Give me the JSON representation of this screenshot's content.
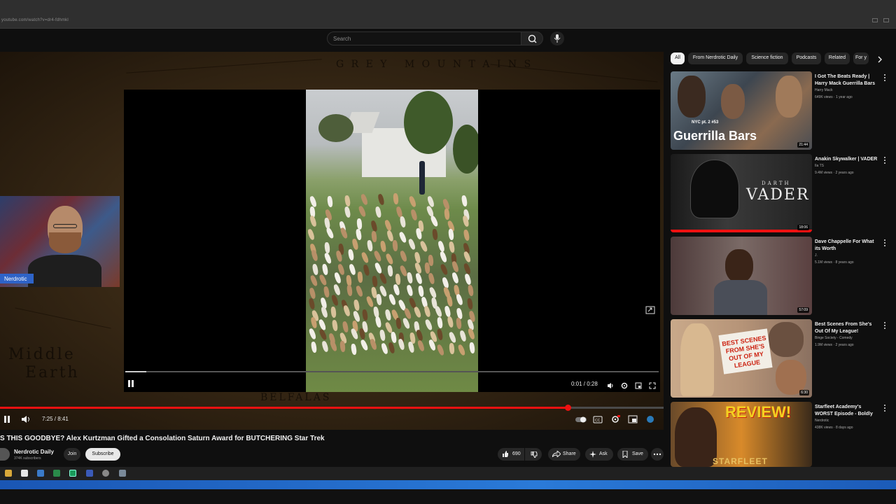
{
  "browser": {
    "url": "youtube.com/watch?v=dr4-fdhmkl"
  },
  "header": {
    "search_placeholder": "Search",
    "icons": [
      "search-icon",
      "microphone-icon"
    ]
  },
  "player": {
    "embedded_video": {
      "current_time": "0:01 / 0:28",
      "progress": 0.04
    },
    "webcam_label": "Nerdrotic",
    "current_time": "7:25 / 8:41",
    "progress": 0.855,
    "colors": {
      "progress": "#ee1111",
      "webcam_label_bg": "#2e63c8"
    }
  },
  "video": {
    "title": "S THIS GOODBYE? Alex Kurtzman Gifted a Consolation Saturn Award for BUTCHERING Star Trek",
    "channel": "Nerdrotic Daily",
    "subscribers": "374K subscribers",
    "join_label": "Join",
    "subscribe_label": "Subscribe",
    "likes": "690",
    "share_label": "Share",
    "ask_label": "Ask",
    "save_label": "Save"
  },
  "chips": [
    "All",
    "From Nerdrotic Daily",
    "Science fiction",
    "Podcasts",
    "Related",
    "For y"
  ],
  "recommendations": [
    {
      "title": "I Got The Beats Ready | Harry Mack Guerrilla Bars ...",
      "channel": "Harry Mack",
      "meta": "649K views · 1 year ago",
      "duration": "21:44",
      "thumb_text": "Guerrilla Bars",
      "thumb_subtext": "NYC pt. 2 #53"
    },
    {
      "title": "Anakin Skywalker | VADER",
      "channel": "Ila TS",
      "meta": "9.4M views · 2 years ago",
      "duration": "18:06",
      "thumb_text": "VADER",
      "thumb_subtext": "DARTH"
    },
    {
      "title": "Dave Chappelle For What its Worth",
      "channel": "J.",
      "meta": "5.1M views · 8 years ago",
      "duration": "57:09"
    },
    {
      "title": "Best Scenes From She's Out Of My League!",
      "channel": "Binge Society - Comedy",
      "meta": "1.9M views · 2 years ago",
      "duration": "6:30",
      "thumb_text": "BEST SCENES FROM SHE'S OUT OF MY LEAGUE"
    },
    {
      "title": "Starfleet Academy's WORST Episode - Boldly Going to ...",
      "channel": "Nerdrotic",
      "meta": "438K views · 8 days ago",
      "thumb_text": "REVIEW!",
      "thumb_subtext": "STARFLEET"
    }
  ]
}
